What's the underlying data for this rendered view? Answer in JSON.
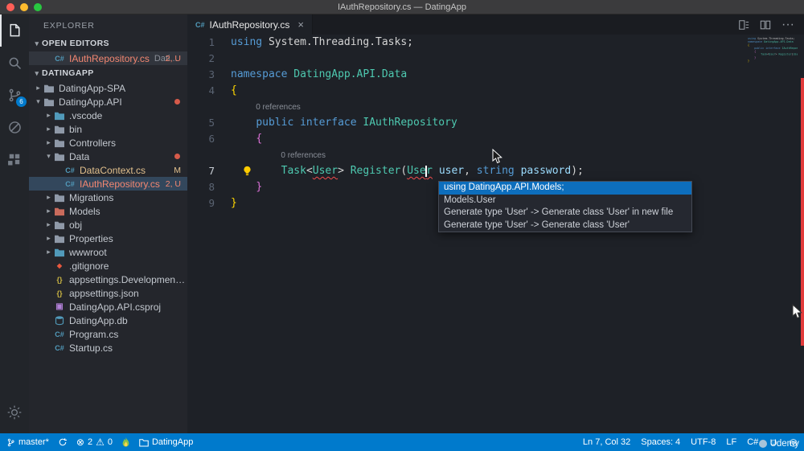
{
  "titlebar": {
    "title": "IAuthRepository.cs — DatingApp"
  },
  "activity_bar": {
    "items": [
      {
        "name": "explorer",
        "icon": "files",
        "active": true
      },
      {
        "name": "search",
        "icon": "search"
      },
      {
        "name": "source-control",
        "icon": "git",
        "badge": "6"
      },
      {
        "name": "debug",
        "icon": "debug"
      },
      {
        "name": "extensions",
        "icon": "ext"
      }
    ],
    "bottom": [
      {
        "name": "settings",
        "icon": "gear"
      }
    ]
  },
  "sidebar": {
    "title": "EXPLORER",
    "sections": {
      "open_editors": "OPEN EDITORS",
      "folder": "DATINGAPP"
    },
    "open_editors": [
      {
        "label": "IAuthRepository.cs",
        "detail": "Dati...",
        "badge": "2, U",
        "color": "#f48771",
        "badgeColor": "#f48771",
        "active": true
      }
    ],
    "tree": [
      {
        "label": "DatingApp-SPA",
        "level": 0,
        "kind": "folder",
        "expanded": false
      },
      {
        "label": "DatingApp.API",
        "level": 0,
        "kind": "folder",
        "expanded": true,
        "dot": true
      },
      {
        "label": ".vscode",
        "level": 1,
        "kind": "folder",
        "expanded": false,
        "iconColor": "#519aba"
      },
      {
        "label": "bin",
        "level": 1,
        "kind": "folder",
        "expanded": false
      },
      {
        "label": "Controllers",
        "level": 1,
        "kind": "folder",
        "expanded": false
      },
      {
        "label": "Data",
        "level": 1,
        "kind": "folder",
        "expanded": true,
        "dot": true
      },
      {
        "label": "DataContext.cs",
        "level": 2,
        "kind": "csharp",
        "color": "#e2c08d",
        "badge": "M",
        "badgeColor": "#e2c08d"
      },
      {
        "label": "IAuthRepository.cs",
        "level": 2,
        "kind": "csharp",
        "color": "#f48771",
        "badge": "2, U",
        "badgeColor": "#f48771",
        "selected": true
      },
      {
        "label": "Migrations",
        "level": 1,
        "kind": "folder",
        "expanded": false
      },
      {
        "label": "Models",
        "level": 1,
        "kind": "folder",
        "expanded": false,
        "iconColor": "#c96b5c"
      },
      {
        "label": "obj",
        "level": 1,
        "kind": "folder",
        "expanded": false
      },
      {
        "label": "Properties",
        "level": 1,
        "kind": "folder",
        "expanded": false
      },
      {
        "label": "wwwroot",
        "level": 1,
        "kind": "folder",
        "expanded": false,
        "iconColor": "#519aba"
      },
      {
        "label": ".gitignore",
        "level": 1,
        "kind": "git"
      },
      {
        "label": "appsettings.Development.js...",
        "level": 1,
        "kind": "json"
      },
      {
        "label": "appsettings.json",
        "level": 1,
        "kind": "json"
      },
      {
        "label": "DatingApp.API.csproj",
        "level": 1,
        "kind": "csproj"
      },
      {
        "label": "DatingApp.db",
        "level": 1,
        "kind": "db"
      },
      {
        "label": "Program.cs",
        "level": 1,
        "kind": "csharp"
      },
      {
        "label": "Startup.cs",
        "level": 1,
        "kind": "csharp"
      }
    ]
  },
  "editor": {
    "tab": {
      "label": "IAuthRepository.cs",
      "close": "×"
    },
    "codelens": "0 references",
    "lines": [
      {
        "num": 1,
        "tokens": [
          {
            "t": "using",
            "c": "kw"
          },
          {
            "t": " ",
            "c": "fg"
          },
          {
            "t": "System.Threading.Tasks",
            "c": "fg"
          },
          {
            "t": ";",
            "c": "fg"
          }
        ]
      },
      {
        "num": 2,
        "tokens": []
      },
      {
        "num": 3,
        "tokens": [
          {
            "t": "namespace",
            "c": "kw"
          },
          {
            "t": " ",
            "c": "fg"
          },
          {
            "t": "DatingApp.API.Data",
            "c": "type"
          }
        ]
      },
      {
        "num": 4,
        "tokens": [
          {
            "t": "{",
            "c": "b1"
          }
        ]
      },
      {
        "lens": true,
        "indent": 4
      },
      {
        "num": 5,
        "tokens": [
          {
            "t": "    ",
            "c": "fg"
          },
          {
            "t": "public",
            "c": "kw"
          },
          {
            "t": " ",
            "c": "fg"
          },
          {
            "t": "interface",
            "c": "kw"
          },
          {
            "t": " ",
            "c": "fg"
          },
          {
            "t": "IAuthRepository",
            "c": "type"
          }
        ]
      },
      {
        "num": 6,
        "tokens": [
          {
            "t": "    ",
            "c": "fg"
          },
          {
            "t": "{",
            "c": "b2"
          }
        ]
      },
      {
        "lens": true,
        "indent": 8
      },
      {
        "num": 7,
        "bulb": true,
        "tokens": [
          {
            "t": "        ",
            "c": "fg"
          },
          {
            "t": "Task",
            "c": "type"
          },
          {
            "t": "<",
            "c": "fg"
          },
          {
            "t": "User",
            "c": "type",
            "err": true
          },
          {
            "t": ">",
            "c": "fg"
          },
          {
            "t": " ",
            "c": "fg"
          },
          {
            "t": "Register",
            "c": "type"
          },
          {
            "t": "(",
            "c": "fg"
          },
          {
            "t": "Use",
            "c": "type",
            "err": true
          },
          {
            "cursor": true
          },
          {
            "t": "r",
            "c": "type",
            "err": true
          },
          {
            "t": " ",
            "c": "fg"
          },
          {
            "t": "user",
            "c": "param"
          },
          {
            "t": ", ",
            "c": "fg"
          },
          {
            "t": "string",
            "c": "kw"
          },
          {
            "t": " ",
            "c": "fg"
          },
          {
            "t": "password",
            "c": "param"
          },
          {
            "t": ");",
            "c": "fg"
          }
        ]
      },
      {
        "num": 8,
        "tokens": [
          {
            "t": "    ",
            "c": "fg"
          },
          {
            "t": "}",
            "c": "b2"
          }
        ]
      },
      {
        "num": 9,
        "tokens": [
          {
            "t": "}",
            "c": "b1"
          }
        ]
      }
    ],
    "popup": {
      "items": [
        {
          "label": "using DatingApp.API.Models;",
          "selected": true
        },
        {
          "label": "Models.User"
        },
        {
          "label": "Generate type 'User' -> Generate class 'User' in new file"
        },
        {
          "label": "Generate type 'User' -> Generate class 'User'"
        }
      ]
    }
  },
  "statusbar": {
    "branch": "master*",
    "errors": "2",
    "warnings": "0",
    "project": "DatingApp",
    "line_col": "Ln 7, Col 32",
    "spaces": "Spaces: 4",
    "encoding": "UTF-8",
    "eol": "LF",
    "language": "C#"
  },
  "watermark": "Udemy"
}
